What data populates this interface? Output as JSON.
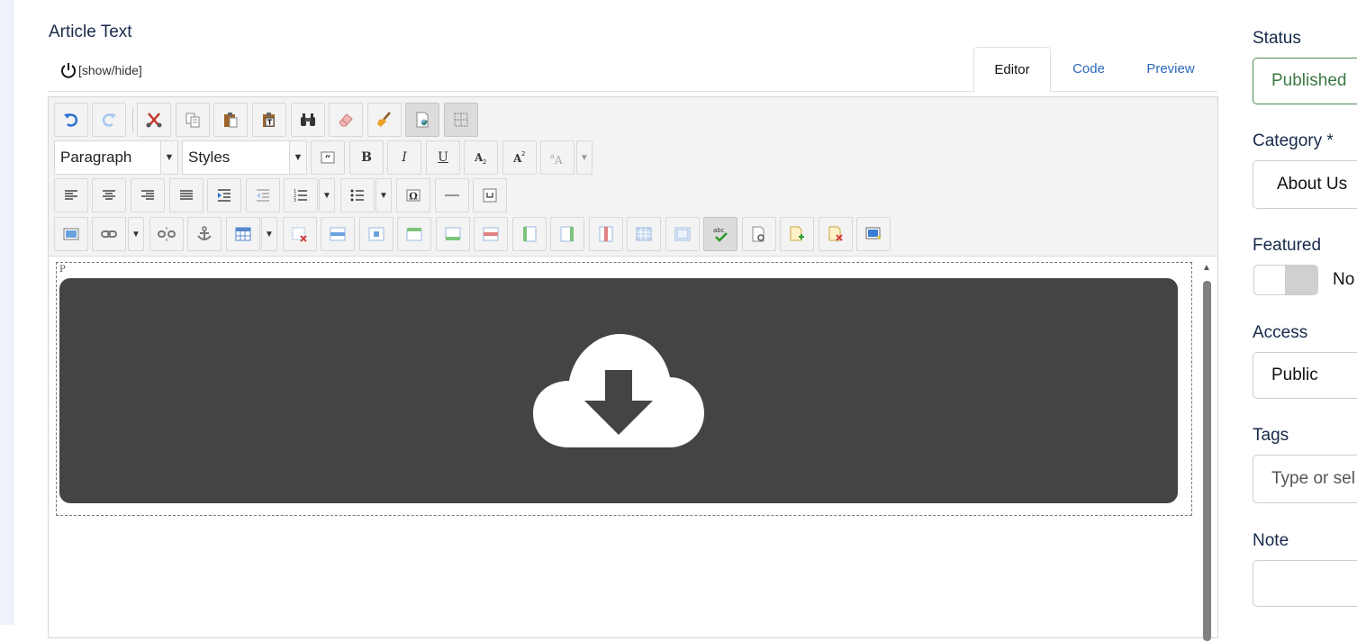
{
  "article": {
    "title": "Article Text",
    "show_hide": "[show/hide]"
  },
  "tabs": [
    {
      "label": "Editor",
      "active": true
    },
    {
      "label": "Code",
      "active": false
    },
    {
      "label": "Preview",
      "active": false
    }
  ],
  "toolbar": {
    "format_select": "Paragraph",
    "styles_select": "Styles",
    "bold": "B",
    "italic": "I",
    "underline": "U"
  },
  "editor_content": {
    "element_path": "P"
  },
  "sidebar": {
    "status_label": "Status",
    "status_value": "Published",
    "category_label": "Category *",
    "category_value": "About Us",
    "featured_label": "Featured",
    "featured_value": "No",
    "access_label": "Access",
    "access_value": "Public",
    "tags_label": "Tags",
    "tags_placeholder": "Type or sel",
    "note_label": "Note",
    "note_value": ""
  },
  "colors": {
    "accent": "#2a69b8",
    "published": "#3d7a44",
    "download_bg": "#444444"
  }
}
